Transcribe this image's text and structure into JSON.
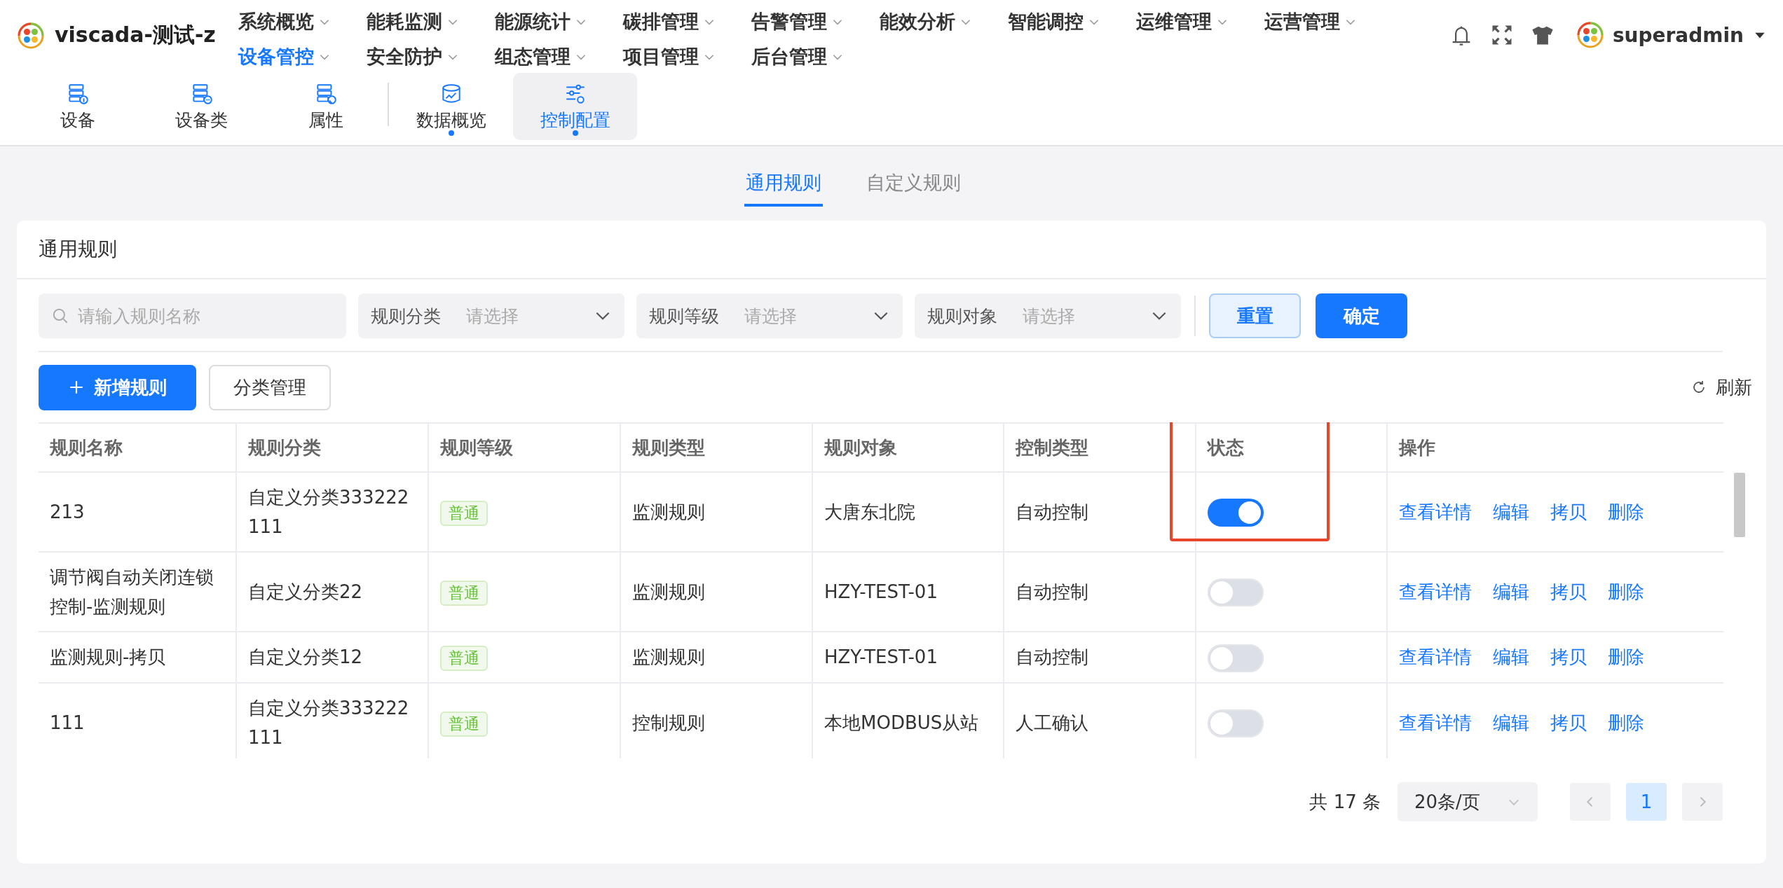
{
  "brand": {
    "title": "viscada-测试-z"
  },
  "nav_menu": [
    {
      "label": "系统概览",
      "selected": false
    },
    {
      "label": "能耗监测",
      "selected": false
    },
    {
      "label": "能源统计",
      "selected": false
    },
    {
      "label": "碳排管理",
      "selected": false
    },
    {
      "label": "告警管理",
      "selected": false
    },
    {
      "label": "能效分析",
      "selected": false
    },
    {
      "label": "智能调控",
      "selected": false
    },
    {
      "label": "运维管理",
      "selected": false
    },
    {
      "label": "运营管理",
      "selected": false
    },
    {
      "label": "设备管控",
      "selected": true
    },
    {
      "label": "安全防护",
      "selected": false
    },
    {
      "label": "组态管理",
      "selected": false
    },
    {
      "label": "项目管理",
      "selected": false
    },
    {
      "label": "后台管理",
      "selected": false
    }
  ],
  "user": {
    "name": "superadmin"
  },
  "sub_nav_groups": [
    [
      {
        "label": "设备",
        "kind": "info",
        "selected": false,
        "dot": false
      },
      {
        "label": "设备类",
        "kind": "more",
        "selected": false,
        "dot": false
      },
      {
        "label": "属性",
        "kind": "pin",
        "selected": false,
        "dot": false
      }
    ],
    [
      {
        "label": "数据概览",
        "kind": "chart",
        "selected": false,
        "dot": true
      },
      {
        "label": "控制配置",
        "kind": "sliders",
        "selected": true,
        "dot": true
      }
    ]
  ],
  "page_tabs": [
    {
      "label": "通用规则",
      "selected": true
    },
    {
      "label": "自定义规则",
      "selected": false
    }
  ],
  "card": {
    "title": "通用规则"
  },
  "filters": {
    "search": {
      "placeholder": "请输入规则名称"
    },
    "selects": [
      {
        "label": "规则分类",
        "placeholder": "请选择"
      },
      {
        "label": "规则等级",
        "placeholder": "请选择"
      },
      {
        "label": "规则对象",
        "placeholder": "请选择"
      }
    ],
    "buttons": [
      {
        "label": "重置",
        "kind": "secondary"
      },
      {
        "label": "确定",
        "kind": "primary"
      }
    ]
  },
  "toolbar": {
    "add_button": "新增规则",
    "category_button": "分类管理",
    "refresh": "刷新"
  },
  "table": {
    "columns": [
      {
        "label": "规则名称",
        "highlighted": false
      },
      {
        "label": "规则分类",
        "highlighted": false
      },
      {
        "label": "规则等级",
        "highlighted": false
      },
      {
        "label": "规则类型",
        "highlighted": false
      },
      {
        "label": "规则对象",
        "highlighted": false
      },
      {
        "label": "控制类型",
        "highlighted": false
      },
      {
        "label": "状态",
        "highlighted": true
      },
      {
        "label": "操作",
        "highlighted": false
      }
    ],
    "rows": [
      {
        "name": "213",
        "category": "自定义分类333222111",
        "level": "普通",
        "type": "监测规则",
        "target": "大唐东北院",
        "control_type": "自动控制",
        "enabled": true,
        "actions": [
          "查看详情",
          "编辑",
          "拷贝",
          "删除"
        ]
      },
      {
        "name": "调节阀自动关闭连锁控制-监测规则",
        "category": "自定义分类22",
        "level": "普通",
        "type": "监测规则",
        "target": "HZY-TEST-01",
        "control_type": "自动控制",
        "enabled": false,
        "actions": [
          "查看详情",
          "编辑",
          "拷贝",
          "删除"
        ]
      },
      {
        "name": "监测规则-拷贝",
        "category": "自定义分类12",
        "level": "普通",
        "type": "监测规则",
        "target": "HZY-TEST-01",
        "control_type": "自动控制",
        "enabled": false,
        "actions": [
          "查看详情",
          "编辑",
          "拷贝",
          "删除"
        ]
      },
      {
        "name": "111",
        "category": "自定义分类333222111",
        "level": "普通",
        "type": "控制规则",
        "target": "本地MODBUS从站",
        "control_type": "人工确认",
        "enabled": false,
        "actions": [
          "查看详情",
          "编辑",
          "拷贝",
          "删除"
        ]
      }
    ]
  },
  "pagination": {
    "total": "共 17 条",
    "page_size": "20条/页",
    "pages": [
      {
        "label": "1",
        "selected": true
      }
    ]
  }
}
